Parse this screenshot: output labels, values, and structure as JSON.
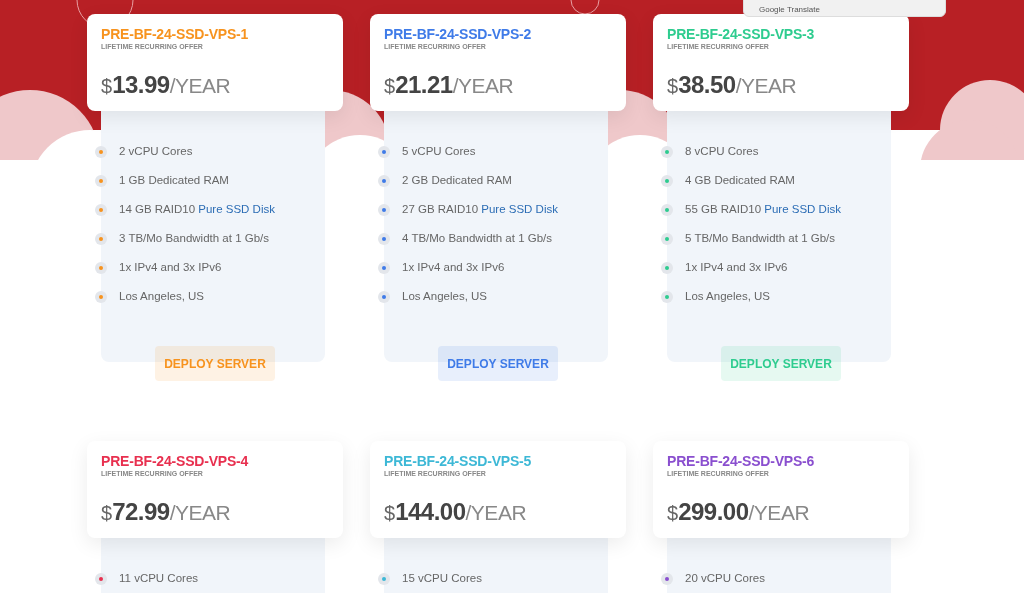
{
  "translate_popup": {
    "label": "Google Translate"
  },
  "plans": [
    {
      "name": "PRE-BF-24-SSD-VPS-1",
      "color": "#f7931e",
      "subtitle": "LIFETIME RECURRING OFFER",
      "currency": "$",
      "price": "13.99",
      "period": "/YEAR",
      "features": [
        {
          "text": "2 vCPU Cores"
        },
        {
          "text": "1 GB Dedicated RAM"
        },
        {
          "text": "14 GB RAID10",
          "link": "Pure SSD Disk"
        },
        {
          "text": "3 TB/Mo Bandwidth at 1 Gb/s"
        },
        {
          "text": "1x IPv4 and 3x IPv6"
        },
        {
          "text": "Los Angeles, US"
        }
      ],
      "button": "DEPLOY SERVER"
    },
    {
      "name": "PRE-BF-24-SSD-VPS-2",
      "color": "#3f7be8",
      "subtitle": "LIFETIME RECURRING OFFER",
      "currency": "$",
      "price": "21.21",
      "period": "/YEAR",
      "features": [
        {
          "text": "5 vCPU Cores"
        },
        {
          "text": "2 GB Dedicated RAM"
        },
        {
          "text": "27 GB RAID10",
          "link": "Pure SSD Disk"
        },
        {
          "text": "4 TB/Mo Bandwidth at 1 Gb/s"
        },
        {
          "text": "1x IPv4 and 3x IPv6"
        },
        {
          "text": "Los Angeles, US"
        }
      ],
      "button": "DEPLOY SERVER"
    },
    {
      "name": "PRE-BF-24-SSD-VPS-3",
      "color": "#2ecc8f",
      "subtitle": "LIFETIME RECURRING OFFER",
      "currency": "$",
      "price": "38.50",
      "period": "/YEAR",
      "features": [
        {
          "text": "8 vCPU Cores"
        },
        {
          "text": "4 GB Dedicated RAM"
        },
        {
          "text": "55 GB RAID10",
          "link": "Pure SSD Disk"
        },
        {
          "text": "5 TB/Mo Bandwidth at 1 Gb/s"
        },
        {
          "text": "1x IPv4 and 3x IPv6"
        },
        {
          "text": "Los Angeles, US"
        }
      ],
      "button": "DEPLOY SERVER"
    },
    {
      "name": "PRE-BF-24-SSD-VPS-4",
      "color": "#e8304f",
      "subtitle": "LIFETIME RECURRING OFFER",
      "currency": "$",
      "price": "72.99",
      "period": "/YEAR",
      "features": [
        {
          "text": "11 vCPU Cores"
        }
      ]
    },
    {
      "name": "PRE-BF-24-SSD-VPS-5",
      "color": "#3db8d6",
      "subtitle": "LIFETIME RECURRING OFFER",
      "currency": "$",
      "price": "144.00",
      "period": "/YEAR",
      "features": [
        {
          "text": "15 vCPU Cores"
        }
      ]
    },
    {
      "name": "PRE-BF-24-SSD-VPS-6",
      "color": "#8a4fcf",
      "subtitle": "LIFETIME RECURRING OFFER",
      "currency": "$",
      "price": "299.00",
      "period": "/YEAR",
      "features": [
        {
          "text": "20 vCPU Cores"
        }
      ]
    }
  ]
}
